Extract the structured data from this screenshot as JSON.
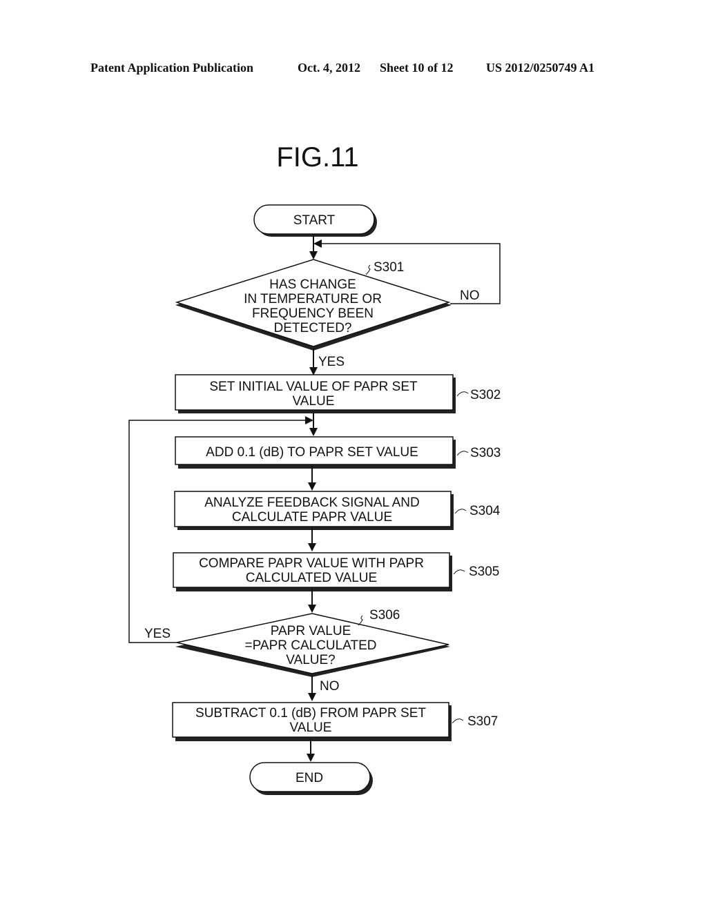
{
  "header": {
    "publication": "Patent Application Publication",
    "date": "Oct. 4, 2012",
    "sheet": "Sheet 10 of 12",
    "number": "US 2012/0250749 A1"
  },
  "figure": {
    "title": "FIG.11",
    "start": "START",
    "end": "END",
    "steps": [
      {
        "id": "S301",
        "type": "decision",
        "lines": [
          "HAS CHANGE",
          "IN TEMPERATURE OR",
          "FREQUENCY BEEN",
          "DETECTED?"
        ],
        "yes": "YES",
        "no": "NO"
      },
      {
        "id": "S302",
        "type": "process",
        "lines": [
          "SET INITIAL VALUE OF PAPR SET",
          "VALUE"
        ]
      },
      {
        "id": "S303",
        "type": "process",
        "lines": [
          "ADD 0.1 (dB) TO PAPR SET VALUE"
        ]
      },
      {
        "id": "S304",
        "type": "process",
        "lines": [
          "ANALYZE FEEDBACK SIGNAL AND",
          "CALCULATE PAPR VALUE"
        ]
      },
      {
        "id": "S305",
        "type": "process",
        "lines": [
          "COMPARE PAPR VALUE WITH PAPR",
          "CALCULATED VALUE"
        ]
      },
      {
        "id": "S306",
        "type": "decision",
        "lines": [
          "PAPR VALUE",
          "=PAPR CALCULATED",
          "VALUE?"
        ],
        "yes": "YES",
        "no": "NO"
      },
      {
        "id": "S307",
        "type": "process",
        "lines": [
          "SUBTRACT 0.1 (dB) FROM PAPR SET",
          "VALUE"
        ]
      }
    ]
  }
}
